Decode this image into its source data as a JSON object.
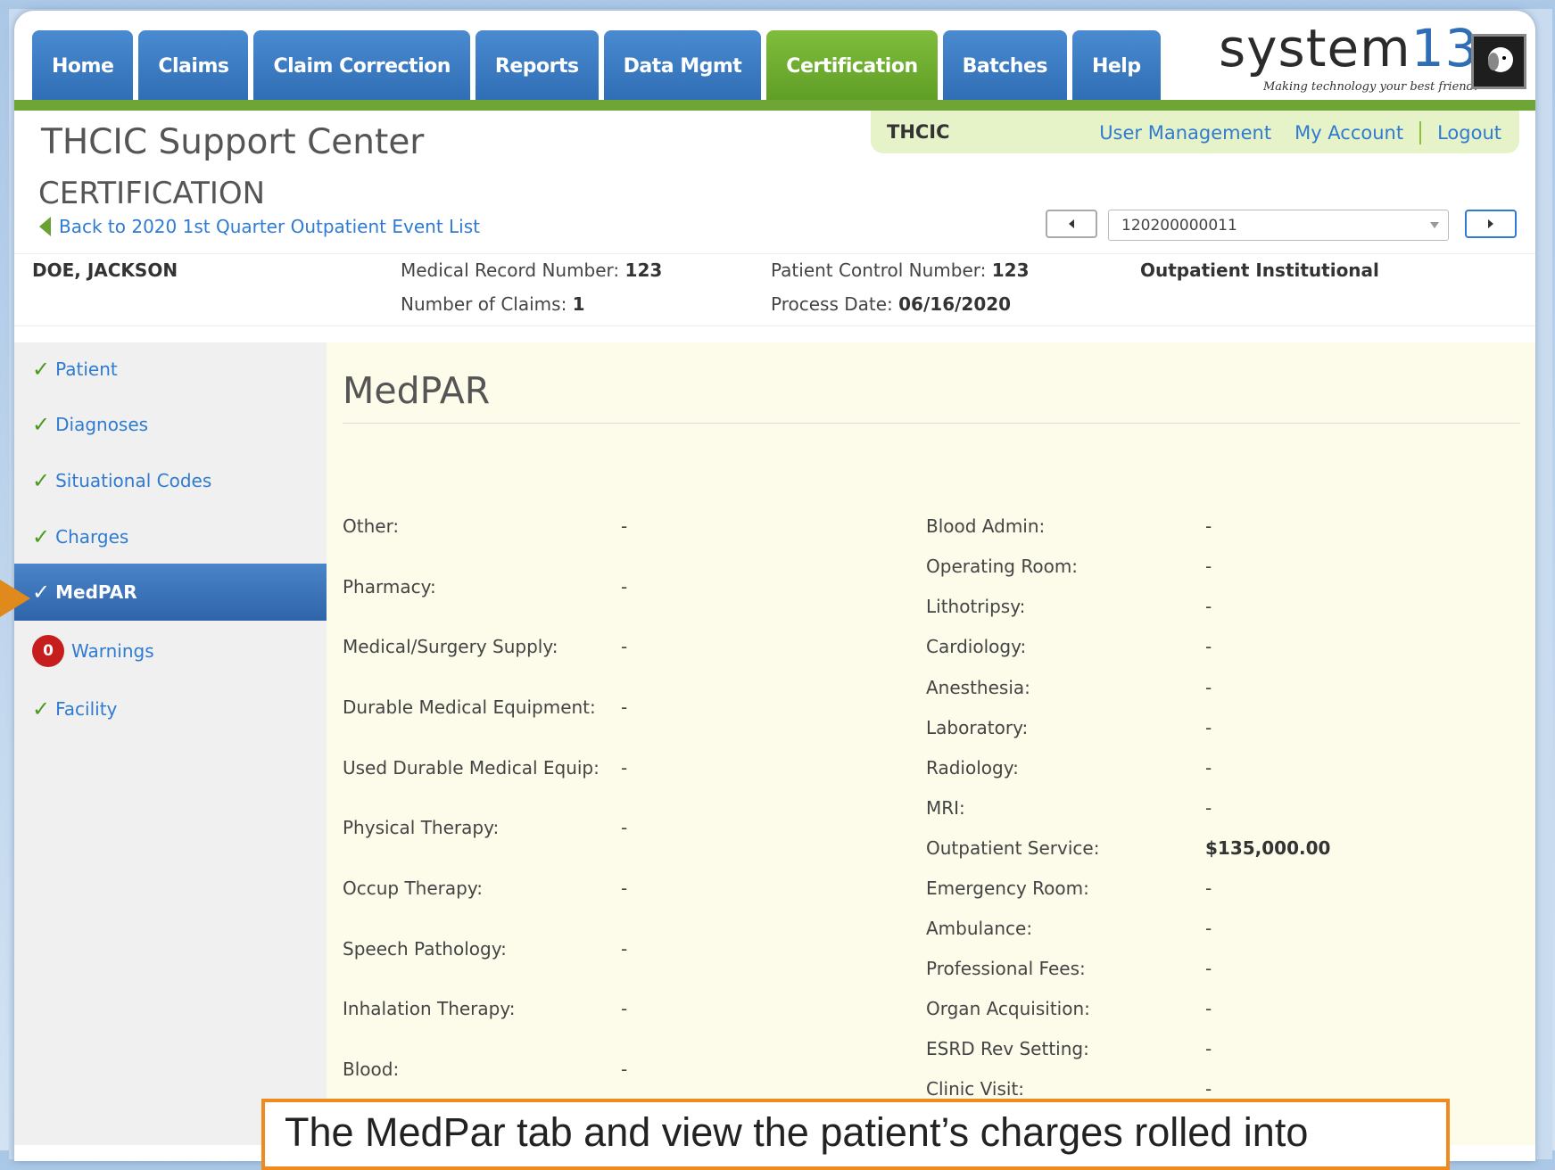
{
  "nav": {
    "tabs": [
      "Home",
      "Claims",
      "Claim Correction",
      "Reports",
      "Data Mgmt",
      "Certification",
      "Batches",
      "Help"
    ],
    "active_tab": "Certification",
    "logo": {
      "name_text": "system",
      "name_num": "13",
      "tagline": "Making technology your best friend."
    }
  },
  "userbar": {
    "org": "THCIC",
    "links": [
      "User Management",
      "My Account",
      "Logout"
    ]
  },
  "header": {
    "site_title": "THCIC Support Center",
    "section_title": "CERTIFICATION",
    "back_link": "Back to 2020 1st Quarter Outpatient Event List"
  },
  "pager": {
    "selected": "120200000011"
  },
  "patient": {
    "name": "DOE, JACKSON",
    "mrn_label": "Medical Record Number:",
    "mrn": "123",
    "claims_label": "Number of Claims:",
    "claims": "1",
    "pcn_label": "Patient Control Number:",
    "pcn": "123",
    "process_label": "Process Date:",
    "process_date": "06/16/2020",
    "type": "Outpatient Institutional"
  },
  "sidebar": {
    "items": [
      {
        "label": "Patient"
      },
      {
        "label": "Diagnoses"
      },
      {
        "label": "Situational Codes"
      },
      {
        "label": "Charges"
      },
      {
        "label": "MedPAR"
      },
      {
        "label": "Warnings",
        "badge": "0"
      },
      {
        "label": "Facility"
      }
    ]
  },
  "medpar": {
    "title": "MedPAR",
    "left": [
      {
        "label": "Other:",
        "value": "-"
      },
      {
        "label": "Pharmacy:",
        "value": "-"
      },
      {
        "label": "Medical/Surgery Supply:",
        "value": "-"
      },
      {
        "label": "Durable Medical Equipment:",
        "value": "-"
      },
      {
        "label": "Used Durable Medical Equip:",
        "value": "-"
      },
      {
        "label": "Physical Therapy:",
        "value": "-"
      },
      {
        "label": "Occup Therapy:",
        "value": "-"
      },
      {
        "label": "Speech Pathology:",
        "value": "-"
      },
      {
        "label": "Inhalation Therapy:",
        "value": "-"
      },
      {
        "label": "Blood:",
        "value": "-"
      }
    ],
    "right": [
      {
        "label": "Blood Admin:",
        "value": "-"
      },
      {
        "label": "Operating Room:",
        "value": "-"
      },
      {
        "label": "Lithotripsy:",
        "value": "-"
      },
      {
        "label": "Cardiology:",
        "value": "-"
      },
      {
        "label": "Anesthesia:",
        "value": "-"
      },
      {
        "label": "Laboratory:",
        "value": "-"
      },
      {
        "label": "Radiology:",
        "value": "-"
      },
      {
        "label": "MRI:",
        "value": "-"
      },
      {
        "label": "Outpatient Service:",
        "value": "$135,000.00"
      },
      {
        "label": "Emergency Room:",
        "value": "-"
      },
      {
        "label": "Ambulance:",
        "value": "-"
      },
      {
        "label": "Professional Fees:",
        "value": "-"
      },
      {
        "label": "Organ Acquisition:",
        "value": "-"
      },
      {
        "label": "ESRD Rev Setting:",
        "value": "-"
      },
      {
        "label": "Clinic Visit:",
        "value": "-"
      }
    ]
  },
  "callout": {
    "text": "The MedPar tab and view the patient’s charges rolled into"
  }
}
